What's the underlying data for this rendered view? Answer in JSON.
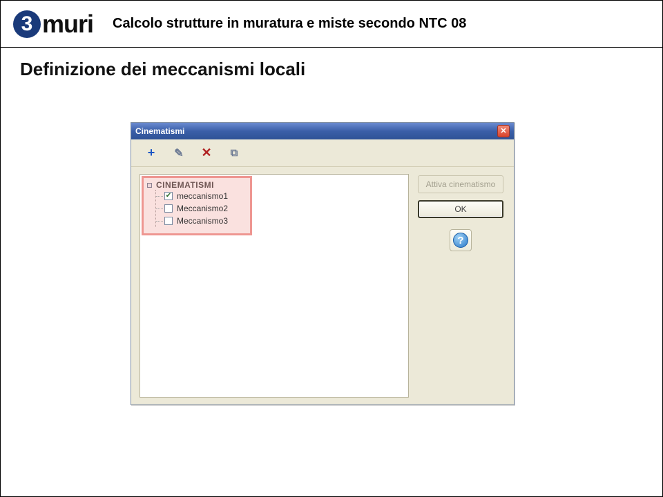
{
  "logo": {
    "badge": "3",
    "text": "muri"
  },
  "header_subtitle": "Calcolo strutture in muratura e miste secondo NTC 08",
  "page_title": "Definizione dei meccanismi locali",
  "dialog": {
    "title": "Cinematismi",
    "close_glyph": "✕",
    "toolbar": {
      "add_glyph": "+",
      "edit_glyph": "✎",
      "delete_glyph": "✕",
      "copy_glyph": "⧉"
    },
    "tree": {
      "root_label": "CINEMATISMI",
      "items": [
        {
          "label": "meccanismo1",
          "checked": true
        },
        {
          "label": "Meccanismo2",
          "checked": false
        },
        {
          "label": "Meccanismo3",
          "checked": false
        }
      ]
    },
    "buttons": {
      "activate_label": "Attiva cinematismo",
      "ok_label": "OK",
      "help_glyph": "?"
    }
  }
}
